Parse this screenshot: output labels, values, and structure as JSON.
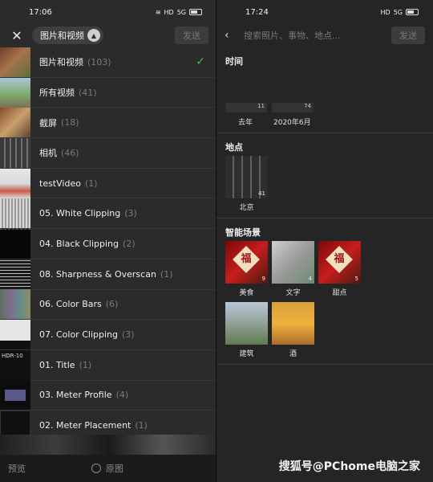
{
  "left": {
    "status": {
      "time": "17:06",
      "net": "HD",
      "signal": "5G"
    },
    "header": {
      "album_title": "图片和视频",
      "send": "发送"
    },
    "albums": [
      {
        "name": "图片和视频",
        "count": "(103)",
        "selected": true
      },
      {
        "name": "所有视频",
        "count": "(41)"
      },
      {
        "name": "截屏",
        "count": "(18)"
      },
      {
        "name": "相机",
        "count": "(46)"
      },
      {
        "name": "testVideo",
        "count": "(1)"
      },
      {
        "name": "05. White Clipping",
        "count": "(3)"
      },
      {
        "name": "04. Black Clipping",
        "count": "(2)"
      },
      {
        "name": "08. Sharpness & Overscan",
        "count": "(1)"
      },
      {
        "name": "06. Color Bars",
        "count": "(6)"
      },
      {
        "name": "07. Color Clipping",
        "count": "(3)"
      },
      {
        "name": "01. Title",
        "count": "(1)"
      },
      {
        "name": "03. Meter Profile",
        "count": "(4)"
      },
      {
        "name": "02. Meter Placement",
        "count": "(1)"
      }
    ],
    "thumb_text_hdr": "HDR-10",
    "footer": {
      "preview": "预览",
      "original": "原图"
    }
  },
  "right": {
    "status": {
      "time": "17:24",
      "net": "HD",
      "signal": "5G"
    },
    "search": {
      "placeholder": "搜索照片、事物、地点...",
      "send": "发送"
    },
    "time_section": {
      "title": "时间",
      "items": [
        {
          "label": "去年",
          "count": "11"
        },
        {
          "label": "2020年6月",
          "count": "74"
        }
      ]
    },
    "place_section": {
      "title": "地点",
      "items": [
        {
          "label": "北京",
          "count": "41"
        }
      ]
    },
    "scene_section": {
      "title": "智能场景",
      "items": [
        {
          "label": "美食",
          "count": "9"
        },
        {
          "label": "文字",
          "count": "4"
        },
        {
          "label": "甜点",
          "count": "5"
        },
        {
          "label": "建筑",
          "count": ""
        },
        {
          "label": "酒",
          "count": ""
        }
      ],
      "fu_char": "福"
    }
  },
  "watermark": "搜狐号@PChome电脑之家"
}
